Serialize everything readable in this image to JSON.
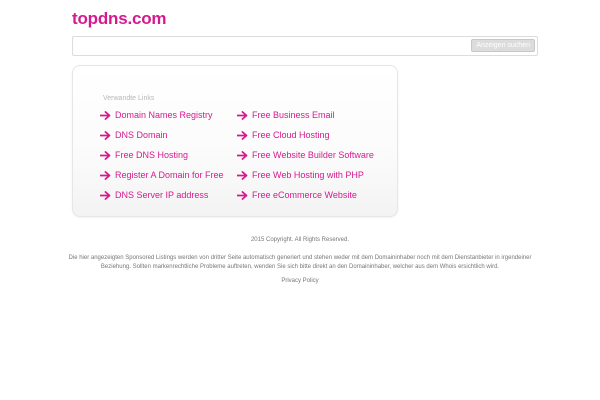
{
  "header": {
    "logo": "topdns.com"
  },
  "search": {
    "placeholder": "",
    "button_label": "Anzeigen suchen"
  },
  "links": {
    "heading": "Verwandte Links",
    "left": [
      "Domain Names Registry",
      "DNS Domain",
      "Free DNS Hosting",
      "Register A Domain for Free",
      "DNS Server IP address"
    ],
    "right": [
      "Free Business Email",
      "Free Cloud Hosting",
      "Free Website Builder Software",
      "Free Web Hosting with PHP",
      "Free eCommerce Website"
    ]
  },
  "footer": {
    "copyright": "2015 Copyright. All Rights Reserved.",
    "disclaimer": "Die hier angezeigten Sponsored Listings werden von dritter Seite automatisch generiert und stehen weder mit dem Domaininhaber noch mit dem Dienstanbieter in irgendeiner Beziehung. Sollten markenrechtliche Probleme auftreten, wenden Sie sich bitte direkt an den Domaininhaber, welcher aus dem Whois ersichtlich wird.",
    "privacy": "Privacy Policy"
  },
  "colors": {
    "accent": "#d6198f",
    "text_muted": "#777777"
  },
  "icons": {
    "link_arrow": "arrow-right-icon"
  }
}
